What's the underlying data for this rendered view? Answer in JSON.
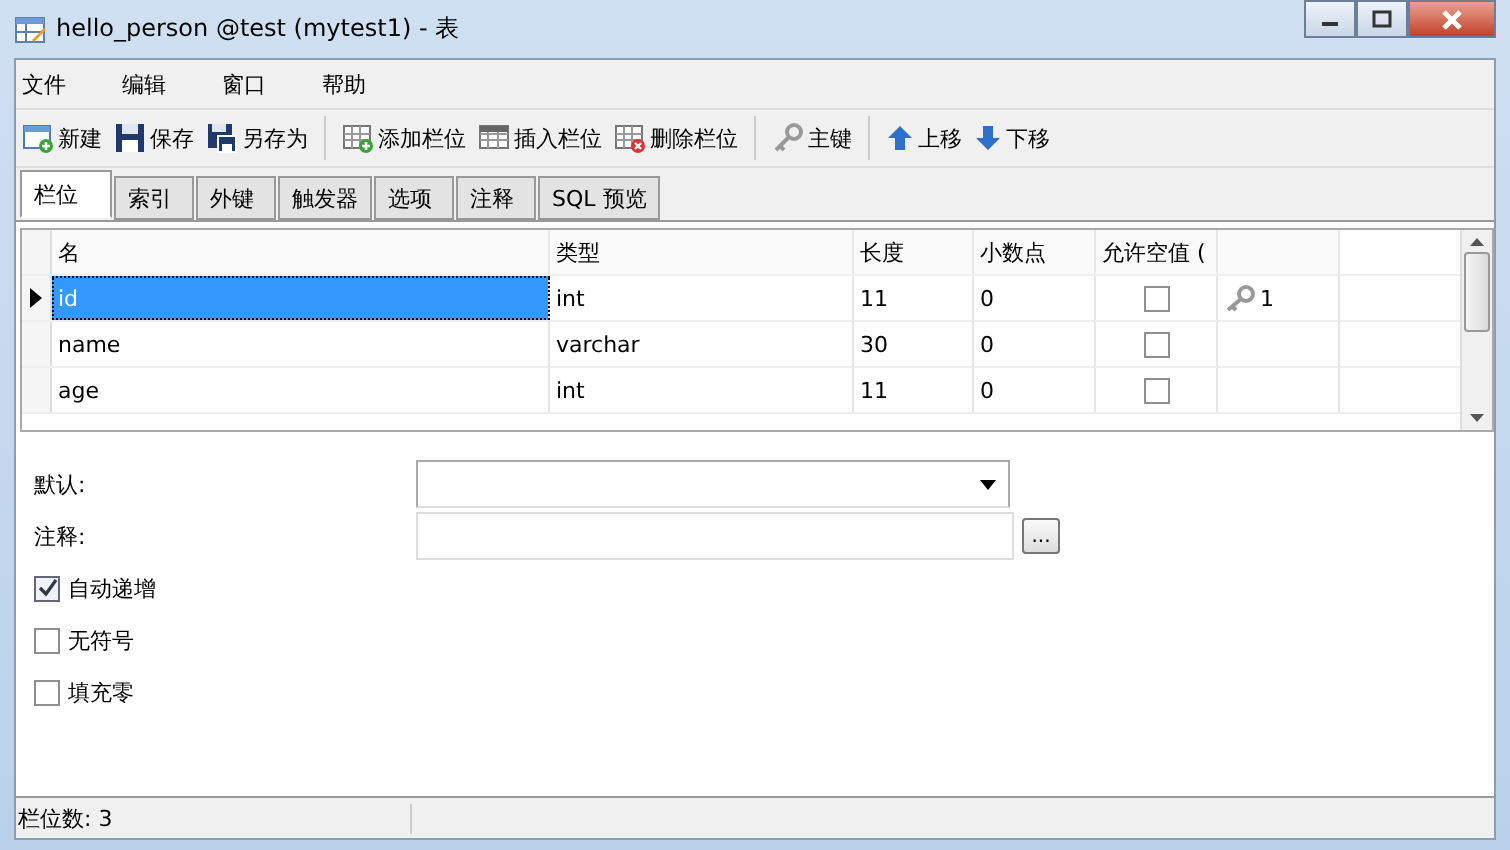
{
  "window": {
    "title": "hello_person @test (mytest1) - 表"
  },
  "menu": [
    "文件",
    "编辑",
    "窗口",
    "帮助"
  ],
  "toolbar": [
    {
      "kind": "new",
      "label": "新建"
    },
    {
      "kind": "save",
      "label": "保存"
    },
    {
      "kind": "saveas",
      "label": "另存为"
    },
    {
      "kind": "sep"
    },
    {
      "kind": "addcol",
      "label": "添加栏位"
    },
    {
      "kind": "inscol",
      "label": "插入栏位"
    },
    {
      "kind": "delcol",
      "label": "删除栏位"
    },
    {
      "kind": "sep"
    },
    {
      "kind": "key",
      "label": "主键"
    },
    {
      "kind": "sep"
    },
    {
      "kind": "up",
      "label": "上移"
    },
    {
      "kind": "down",
      "label": "下移"
    }
  ],
  "tabs": [
    {
      "label": "栏位",
      "selected": true
    },
    {
      "label": "索引",
      "selected": false
    },
    {
      "label": "外键",
      "selected": false
    },
    {
      "label": "触发器",
      "selected": false
    },
    {
      "label": "选项",
      "selected": false
    },
    {
      "label": "注释",
      "selected": false
    },
    {
      "label": "SQL 预览",
      "selected": false
    }
  ],
  "table": {
    "columns": [
      "名",
      "类型",
      "长度",
      "小数点",
      "允许空值 ("
    ],
    "rows": [
      {
        "name": "id",
        "type": "int",
        "length": "11",
        "decimals": "0",
        "allow_null": false,
        "key": "1",
        "selected": true
      },
      {
        "name": "name",
        "type": "varchar",
        "length": "30",
        "decimals": "0",
        "allow_null": false,
        "selected": false
      },
      {
        "name": "age",
        "type": "int",
        "length": "11",
        "decimals": "0",
        "allow_null": false,
        "selected": false
      }
    ]
  },
  "form": {
    "default_label": "默认:",
    "comment_label": "注释:",
    "browse_button": "...",
    "options": [
      {
        "label": "自动递增",
        "checked": true
      },
      {
        "label": "无符号",
        "checked": false
      },
      {
        "label": "填充零",
        "checked": false
      }
    ]
  },
  "status_bar": "栏位数: 3"
}
